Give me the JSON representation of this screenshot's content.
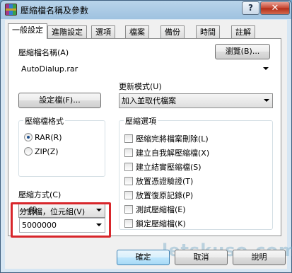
{
  "window": {
    "title": "壓縮檔名稱及參數",
    "help_label": "?",
    "close_label": "✕"
  },
  "tabs": [
    {
      "label": "一般設定",
      "active": true
    },
    {
      "label": "進階設定"
    },
    {
      "label": "選項"
    },
    {
      "label": "檔案"
    },
    {
      "label": "備份"
    },
    {
      "label": "時間"
    },
    {
      "label": "註解"
    }
  ],
  "general": {
    "archive_name_label": "壓縮檔名稱(A)",
    "browse_label": "瀏覽(B)...",
    "archive_name_value": "AutoDialup.rar",
    "update_mode_label": "更新模式(U)",
    "update_mode_value": "加入並取代檔案",
    "profiles_label": "設定檔(F)...",
    "format_group": {
      "title": "壓縮檔格式",
      "options": [
        {
          "label": "RAR(R)",
          "checked": true
        },
        {
          "label": "ZIP(Z)",
          "checked": false
        }
      ]
    },
    "compression_label": "壓縮方式(C)",
    "compression_value": "一般",
    "split_label": "分割檔，位元組(V)",
    "split_value": "5000000",
    "options_group": {
      "title": "壓縮選項",
      "items": [
        "壓縮完將檔案刪除(L)",
        "建立自我解壓縮檔(X)",
        "建立結實壓縮檔(S)",
        "放置憑證驗證(T)",
        "放置復原記錄(P)",
        "測試壓縮檔(E)",
        "鎖定壓縮檔(K)"
      ]
    }
  },
  "buttons": {
    "ok": "確定",
    "cancel": "取消",
    "help": "說明"
  },
  "watermark": "letskuso.com",
  "colors": {
    "highlight": "#d8262b",
    "titlebar": "#9fc2e0"
  }
}
